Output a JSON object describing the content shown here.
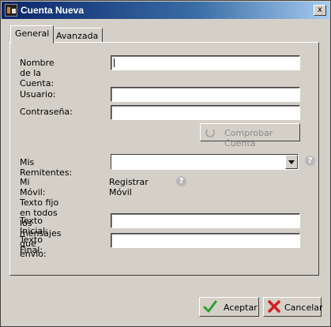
{
  "window": {
    "title": "Cuenta Nueva",
    "close_label": "x"
  },
  "tabs": [
    {
      "label": "General"
    },
    {
      "label": "Avanzada"
    }
  ],
  "form": {
    "account_name_label": "Nombre de la Cuenta:",
    "account_name_value": "",
    "user_label": "Usuario:",
    "user_value": "",
    "password_label": "Contraseña:",
    "password_value": "",
    "check_account_label": "Comprobar Cuenta",
    "senders_label": "Mis Remitentes:",
    "senders_value": "",
    "mobile_label": "Mi Móvil:",
    "register_mobile_label": "Registrar Móvil",
    "fixed_text_heading": "Texto fijo en todos los mensajes que envío:",
    "start_text_label": "Texto Inicial:",
    "start_text_value": "",
    "end_text_label": "Texto Final:",
    "end_text_value": "",
    "help_glyph": "?"
  },
  "footer": {
    "accept_label": "Aceptar",
    "cancel_label": "Cancelar"
  }
}
